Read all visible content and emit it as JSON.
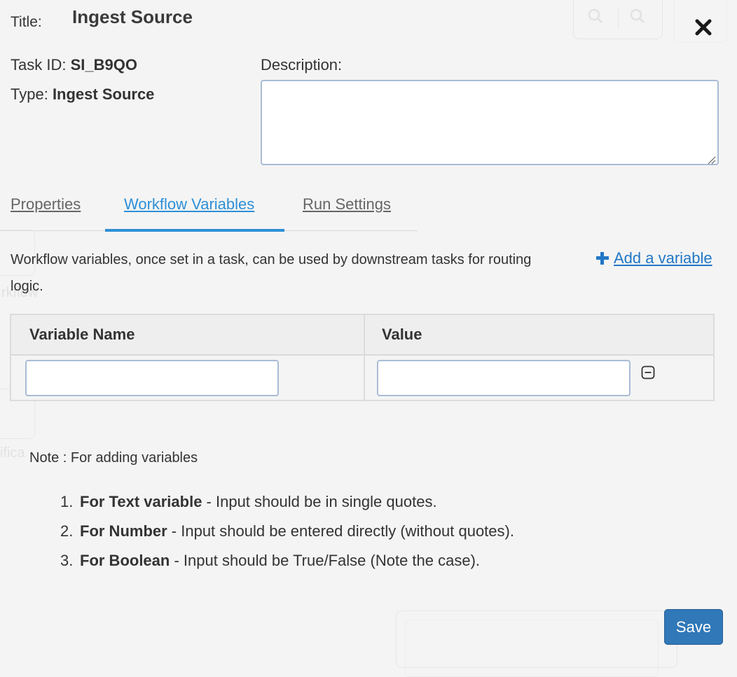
{
  "header": {
    "title_label": "Title:",
    "title_value": "Ingest Source",
    "task_id_label": "Task ID:",
    "task_id_value": "SI_B9QO",
    "type_label": "Type:",
    "type_value": "Ingest Source",
    "description_label": "Description:",
    "description_value": ""
  },
  "tabs": [
    {
      "label": "Properties",
      "active": false
    },
    {
      "label": "Workflow Variables",
      "active": true
    },
    {
      "label": "Run Settings",
      "active": false
    }
  ],
  "workflow": {
    "info": "Workflow variables, once set in a task, can be used by downstream tasks for routing logic.",
    "add_variable_label": "Add a variable",
    "table": {
      "columns": [
        "Variable Name",
        "Value"
      ],
      "rows": [
        {
          "name": "",
          "value": ""
        }
      ]
    },
    "note_title": "Note : For adding variables",
    "notes": [
      {
        "num": "1.",
        "bold": "For Text variable",
        "text": " - Input should be in single quotes."
      },
      {
        "num": "2.",
        "bold": "For Number",
        "text": " - Input should be entered directly (without quotes)."
      },
      {
        "num": "3.",
        "bold": "For Boolean",
        "text": " - Input should be True/False (Note the case)."
      }
    ]
  },
  "actions": {
    "save_label": "Save"
  },
  "background_ghost": {
    "side_text_1": "rkflow",
    "side_text_2": "ifica"
  },
  "colors": {
    "accent": "#2e8fd6",
    "link": "#2277c7",
    "save_button": "#3078b8",
    "input_border": "#a9bcd6",
    "background": "#f4f4f4"
  },
  "icons": {
    "close": "close-x-icon",
    "add": "plus-icon",
    "remove": "minus-square-icon",
    "resize": "resize-grip-icon"
  }
}
